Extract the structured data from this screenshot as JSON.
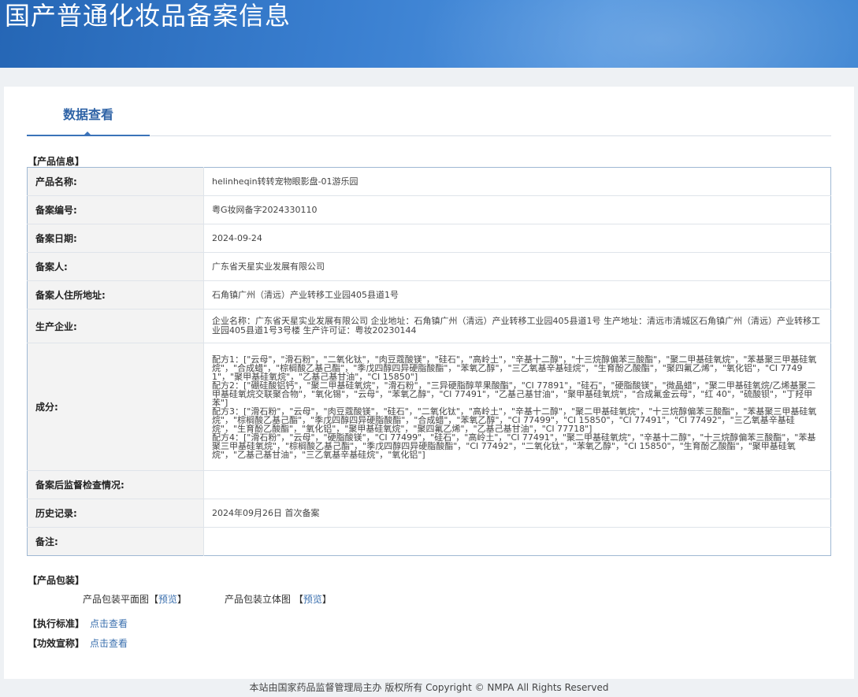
{
  "header": {
    "title": "国产普通化妆品备案信息"
  },
  "tabs": [
    {
      "label": "数据查看"
    }
  ],
  "product_info": {
    "section_label": "【产品信息】",
    "rows": [
      {
        "key": "产品名称:",
        "value": "helinheqin转转宠物眼影盘-01游乐园"
      },
      {
        "key": "备案编号:",
        "value": "粤G妆网备字2024330110"
      },
      {
        "key": "备案日期:",
        "value": "2024-09-24"
      },
      {
        "key": "备案人:",
        "value": "广东省天星实业发展有限公司"
      },
      {
        "key": "备案人住所地址:",
        "value": "石角镇广州（清远）产业转移工业园405县道1号"
      },
      {
        "key": "生产企业:",
        "value": "企业名称：广东省天星实业发展有限公司 企业地址：石角镇广州（清远）产业转移工业园405县道1号 生产地址：清远市清城区石角镇广州（清远）产业转移工业园405县道1号3号楼 生产许可证：粤妆20230144"
      },
      {
        "key": "成分:",
        "value": "配方1：[\"云母\"，\"滑石粉\"，\"二氧化钛\"，\"肉豆蔻酸镁\"，\"硅石\"，\"高岭土\"，\"辛基十二醇\"，\"十三烷醇偏苯三酸酯\"，\"聚二甲基硅氧烷\"，\"苯基聚三甲基硅氧烷\"，\"合成蜡\"，\"棕榈酸乙基己酯\"，\"季戊四醇四异硬脂酸酯\"，\"苯氧乙醇\"，\"三乙氧基辛基硅烷\"，\"生育酚乙酸酯\"，\"聚四氟乙烯\"，\"氧化铝\"，\"CI 77491\"，\"聚甲基硅氧烷\"，\"乙基己基甘油\"，\"CI 15850\"]\n配方2：[\"硼硅酸铝钙\"，\"聚二甲基硅氧烷\"，\"滑石粉\"，\"三异硬脂醇苹果酸酯\"，\"CI 77891\"，\"硅石\"，\"硬脂酸镁\"，\"微晶蜡\"，\"聚二甲基硅氧烷/乙烯基聚二甲基硅氧烷交联聚合物\"，\"氧化锡\"，\"云母\"，\"苯氧乙醇\"，\"CI 77491\"，\"乙基己基甘油\"，\"聚甲基硅氧烷\"，\"合成氟金云母\"，\"红 40\"，\"硫酸钡\"，\"丁羟甲苯\"]\n配方3：[\"滑石粉\"，\"云母\"，\"肉豆蔻酸镁\"，\"硅石\"，\"二氧化钛\"，\"高岭土\"，\"辛基十二醇\"，\"聚二甲基硅氧烷\"，\"十三烷醇偏苯三酸酯\"，\"苯基聚三甲基硅氧烷\"，\"棕榈酸乙基己酯\"，\"季戊四醇四异硬脂酸酯\"，\"合成蜡\"，\"苯氧乙醇\"，\"CI 77499\"，\"CI 15850\"，\"CI 77491\"，\"CI 77492\"，\"三乙氧基辛基硅烷\"，\"生育酚乙酸酯\"，\"氧化铝\"，\"聚甲基硅氧烷\"，\"聚四氟乙烯\"，\"乙基己基甘油\"，\"CI 77718\"]\n配方4：[\"滑石粉\"，\"云母\"，\"硬脂酸镁\"，\"CI 77499\"，\"硅石\"，\"高岭土\"，\"CI 77491\"，\"聚二甲基硅氧烷\"，\"辛基十二醇\"，\"十三烷醇偏苯三酸酯\"，\"苯基聚三甲基硅氧烷\"，\"棕榈酸乙基己酯\"，\"季戊四醇四异硬脂酸酯\"，\"CI 77492\"，\"二氧化钛\"，\"苯氧乙醇\"，\"CI 15850\"，\"生育酚乙酸酯\"，\"聚甲基硅氧烷\"，\"乙基己基甘油\"，\"三乙氧基辛基硅烷\"，\"氧化铝\"]"
      },
      {
        "key": "备案后监督检查情况:",
        "value": ""
      },
      {
        "key": "历史记录:",
        "value": "2024年09月26日 首次备案"
      },
      {
        "key": "备注:",
        "value": ""
      }
    ]
  },
  "packaging": {
    "section_label": "【产品包装】",
    "flat_label": "产品包装平面图",
    "flat_link": "预览",
    "solid_label": "产品包装立体图",
    "solid_link": "预览",
    "bracket_open": "【",
    "bracket_close": "】"
  },
  "standard": {
    "label": "【执行标准】",
    "link": "点击查看"
  },
  "efficacy": {
    "label": "【功效宣称】",
    "link": "点击查看"
  },
  "footer": {
    "text": "本站由国家药品监督管理局主办 版权所有 Copyright © NMPA All Rights Reserved"
  }
}
